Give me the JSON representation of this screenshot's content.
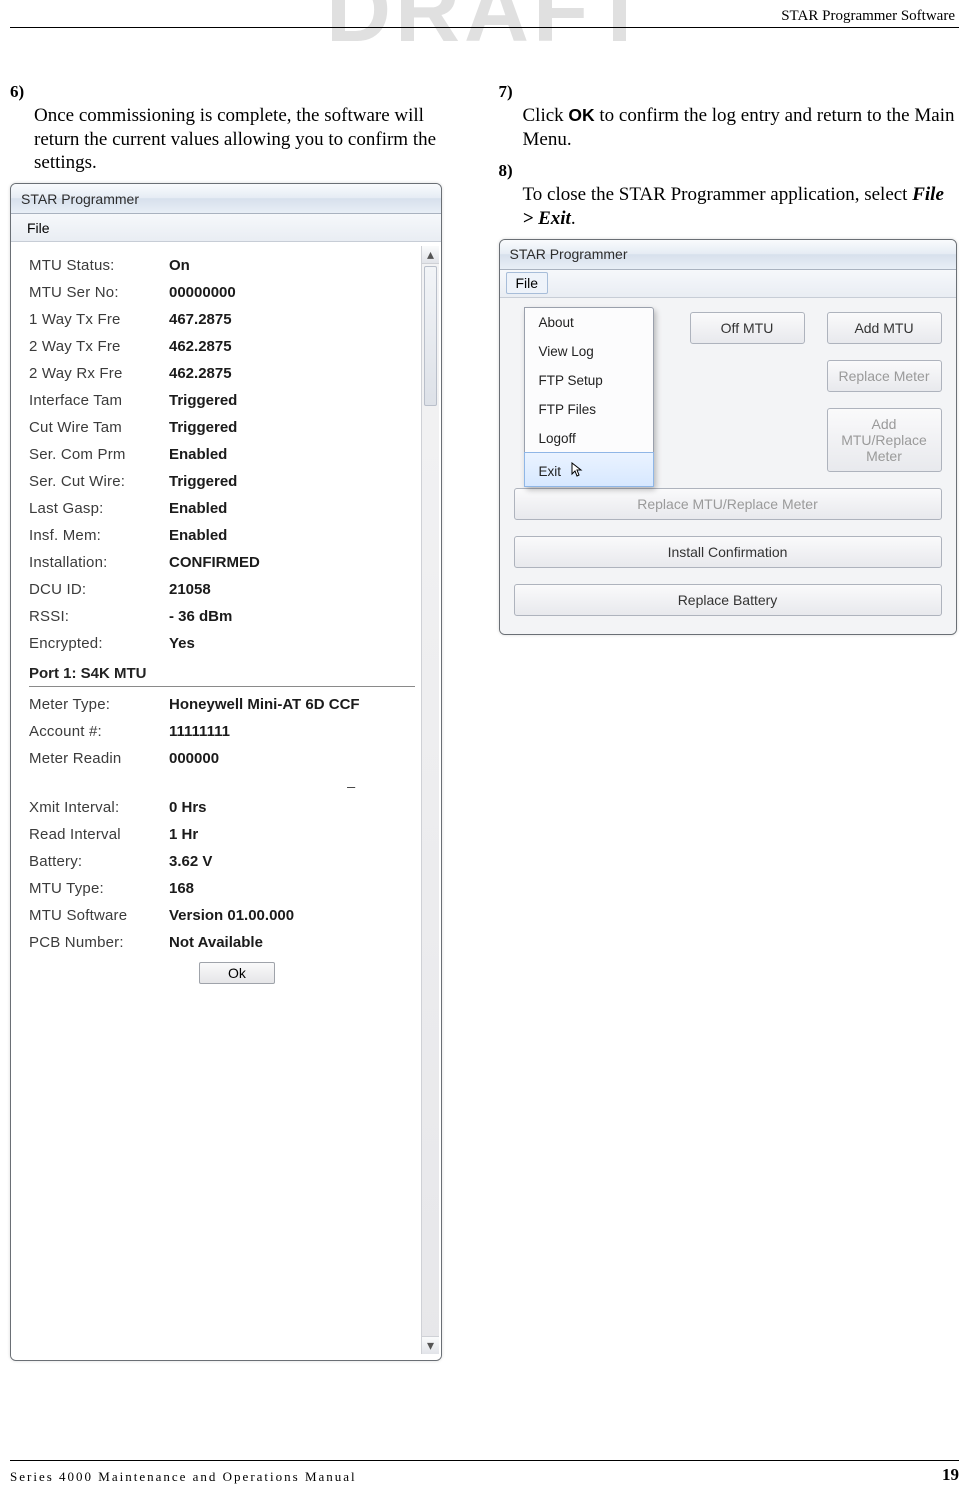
{
  "watermark": "DRAFT",
  "header": {
    "section": "STAR Programmer Software"
  },
  "steps": {
    "s6": {
      "num": "6)",
      "text": "Once commissioning is complete, the software will return the current values allowing you to confirm the settings."
    },
    "s7": {
      "num": "7)",
      "text_a": "Click ",
      "ok": "OK",
      "text_b": " to confirm the log entry and return to the Main Menu."
    },
    "s8": {
      "num": "8)",
      "text_a": "To close the STAR Programmer application, select ",
      "path": "File > Exit",
      "text_b": "."
    }
  },
  "win1": {
    "title": "STAR Programmer",
    "menu_file": "File",
    "fields": [
      {
        "k": "MTU Status:",
        "v": "On"
      },
      {
        "k": "MTU Ser No:",
        "v": "00000000"
      },
      {
        "k": "1 Way Tx Fre",
        "v": "467.2875"
      },
      {
        "k": "2 Way Tx Fre",
        "v": "462.2875"
      },
      {
        "k": "2 Way Rx Fre",
        "v": "462.2875"
      },
      {
        "k": "Interface Tam",
        "v": "Triggered"
      },
      {
        "k": "Cut Wire Tam",
        "v": "Triggered"
      },
      {
        "k": "Ser. Com Prm",
        "v": "Enabled"
      },
      {
        "k": "Ser. Cut Wire:",
        "v": "Triggered"
      },
      {
        "k": "Last Gasp:",
        "v": "Enabled"
      },
      {
        "k": "Insf. Mem:",
        "v": "Enabled"
      },
      {
        "k": "Installation:",
        "v": "CONFIRMED"
      },
      {
        "k": "DCU ID:",
        "v": "21058"
      },
      {
        "k": "RSSI:",
        "v": "- 36 dBm"
      },
      {
        "k": "Encrypted:",
        "v": "Yes"
      }
    ],
    "port_header": "Port 1: S4K MTU",
    "fields2": [
      {
        "k": "Meter Type:",
        "v": "Honeywell Mini-AT 6D CCF"
      },
      {
        "k": "Account #:",
        "v": "11111111"
      },
      {
        "k": "Meter Readin",
        "v": "000000"
      }
    ],
    "fields3": [
      {
        "k": "Xmit Interval:",
        "v": "0 Hrs"
      },
      {
        "k": "Read Interval",
        "v": "1 Hr"
      },
      {
        "k": "Battery:",
        "v": "3.62 V"
      },
      {
        "k": "MTU Type:",
        "v": "168"
      },
      {
        "k": "MTU Software",
        "v": "Version 01.00.000"
      },
      {
        "k": "PCB Number:",
        "v": "Not Available"
      }
    ],
    "ok_label": "Ok"
  },
  "win2": {
    "title": "STAR Programmer",
    "menu_file": "File",
    "dropdown": {
      "items": [
        "About",
        "View Log",
        "FTP Setup",
        "FTP Files",
        "Logoff"
      ],
      "hover": "Exit"
    },
    "buttons": {
      "off_mtu": "Off MTU",
      "add_mtu": "Add MTU",
      "replace_meter": "Replace Meter",
      "add_mtu_replace_meter": "Add MTU/Replace Meter",
      "replace_mtu_replace_meter": "Replace MTU/Replace Meter",
      "install_confirmation": "Install Confirmation",
      "replace_battery": "Replace Battery"
    }
  },
  "footer": {
    "manual": "Series 4000 Maintenance and Operations Manual",
    "page": "19"
  }
}
